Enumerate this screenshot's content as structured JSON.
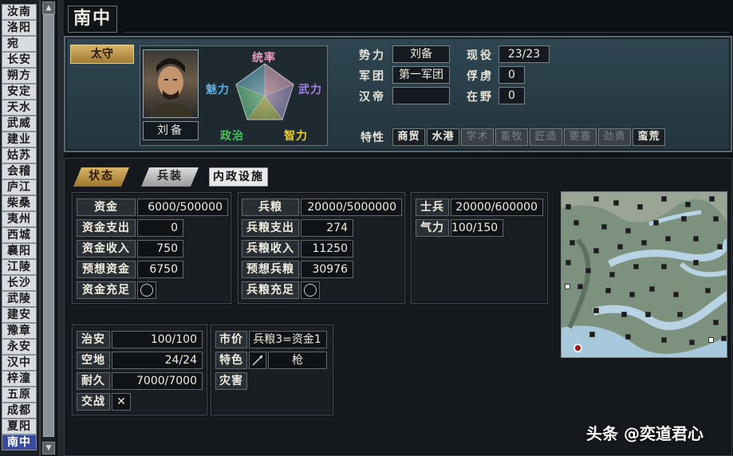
{
  "city_list": [
    "汝南",
    "洛阳",
    "宛",
    "长安",
    "朔方",
    "安定",
    "天水",
    "武威",
    "建业",
    "姑苏",
    "会稽",
    "庐江",
    "柴桑",
    "夷州",
    "西城",
    "襄阳",
    "江陵",
    "长沙",
    "武陵",
    "建安",
    "豫章",
    "永安",
    "汉中",
    "梓潼",
    "五原",
    "成都",
    "夏阳",
    "南中"
  ],
  "selected_city": "南中",
  "header": {
    "title": "南中"
  },
  "governor": {
    "role_label": "太守",
    "name": "刘备"
  },
  "radar_labels": {
    "top": "统率",
    "right": "武力",
    "bottom_right": "智力",
    "bottom_left": "政治",
    "left": "魅力"
  },
  "radar_colors": {
    "top": "#e8a0c0",
    "right": "#a080e0",
    "bottom_right": "#e8d040",
    "bottom_left": "#50c060",
    "left": "#60b0e0"
  },
  "info": {
    "faction_label": "势力",
    "faction": "刘备",
    "corps_label": "军团",
    "corps": "第一军团",
    "emperor_label": "汉帝",
    "emperor": "",
    "serving_label": "现役",
    "serving": "23/23",
    "captive_label": "俘虏",
    "captive": "0",
    "wild_label": "在野",
    "wild": "0"
  },
  "traits": {
    "label": "特性",
    "items": [
      {
        "name": "商贸",
        "active": true
      },
      {
        "name": "水港",
        "active": true
      },
      {
        "name": "学术",
        "active": false
      },
      {
        "name": "畜牧",
        "active": false
      },
      {
        "name": "匠造",
        "active": false
      },
      {
        "name": "要塞",
        "active": false
      },
      {
        "name": "劲勇",
        "active": false
      },
      {
        "name": "蛮荒",
        "active": true
      }
    ]
  },
  "tabs": [
    "状态",
    "兵装",
    "内政设施"
  ],
  "funds": {
    "funds_label": "资金",
    "funds": "6000/500000",
    "expense_label": "资金支出",
    "expense": "0",
    "income_label": "资金收入",
    "income": "750",
    "forecast_label": "预想资金",
    "forecast": "6750",
    "sufficient_label": "资金充足"
  },
  "food": {
    "food_label": "兵粮",
    "food": "20000/5000000",
    "expense_label": "兵粮支出",
    "expense": "274",
    "income_label": "兵粮收入",
    "income": "11250",
    "forecast_label": "预想兵粮",
    "forecast": "30976",
    "sufficient_label": "兵粮充足"
  },
  "troops": {
    "soldiers_label": "士兵",
    "soldiers": "20000/600000",
    "morale_label": "气力",
    "morale": "100/150"
  },
  "city_stats": {
    "order_label": "治安",
    "order": "100/100",
    "land_label": "空地",
    "land": "24/24",
    "durability_label": "耐久",
    "durability": "7000/7000",
    "battle_label": "交战",
    "battle_mark": "✕"
  },
  "market": {
    "price_label": "市价",
    "price": "兵粮3=资金1",
    "special_label": "特色",
    "special": "枪",
    "disaster_label": "灾害"
  },
  "watermark": "头条 @奕道君心"
}
